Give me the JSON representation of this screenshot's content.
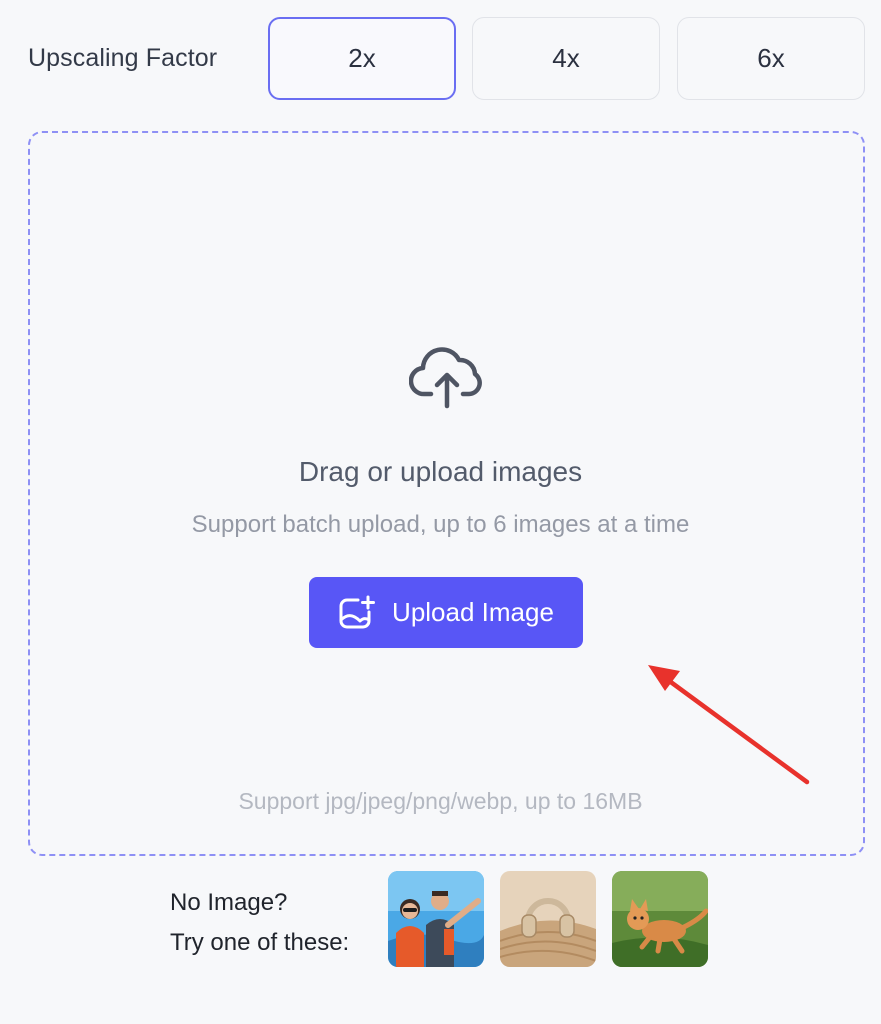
{
  "upscaling": {
    "label": "Upscaling Factor",
    "options": [
      "2x",
      "4x",
      "6x"
    ],
    "selected": "2x"
  },
  "dropzone": {
    "icon": "cloud-upload-icon",
    "title": "Drag or upload images",
    "subtitle": "Support batch upload, up to 6 images at a time",
    "button_label": "Upload Image",
    "button_icon": "image-add-icon",
    "formats_note": "Support jpg/jpeg/png/webp, up to 16MB"
  },
  "samples": {
    "line1": "No Image?",
    "line2": "Try one of these:",
    "thumbnails": [
      "sample-people-icon",
      "sample-headphones-icon",
      "sample-kitten-icon"
    ]
  },
  "colors": {
    "accent": "#5856f6",
    "selected_border": "#6a6ef2",
    "dashed_border": "#8e90f5",
    "annotation_arrow": "#e8322c"
  }
}
